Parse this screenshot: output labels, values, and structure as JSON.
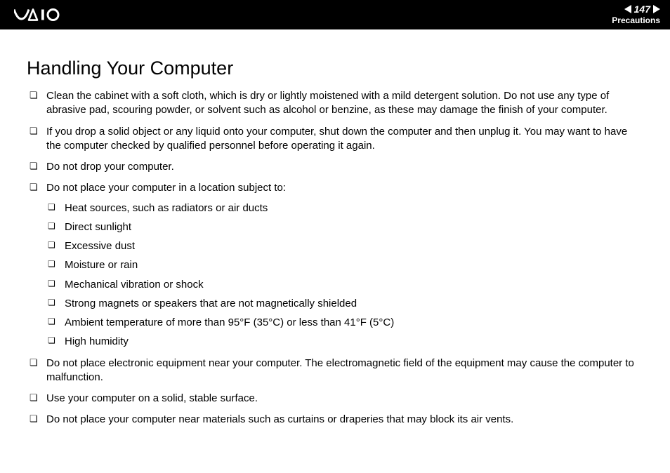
{
  "header": {
    "page_number": "147",
    "section": "Precautions"
  },
  "title": "Handling Your Computer",
  "items": [
    "Clean the cabinet with a soft cloth, which is dry or lightly moistened with a mild detergent solution. Do not use any type of abrasive pad, scouring powder, or solvent such as alcohol or benzine, as these may damage the finish of your computer.",
    "If you drop a solid object or any liquid onto your computer, shut down the computer and then unplug it. You may want to have the computer checked by qualified personnel before operating it again.",
    "Do not drop your computer.",
    "Do not place your computer in a location subject to:",
    "Do not place electronic equipment near your computer. The electromagnetic field of the equipment may cause the computer to malfunction.",
    "Use your computer on a solid, stable surface.",
    "Do not place your computer near materials such as curtains or draperies that may block its air vents."
  ],
  "sub_items": [
    "Heat sources, such as radiators or air ducts",
    "Direct sunlight",
    "Excessive dust",
    "Moisture or rain",
    "Mechanical vibration or shock",
    "Strong magnets or speakers that are not magnetically shielded",
    "Ambient temperature of more than 95°F (35°C) or less than 41°F (5°C)",
    "High humidity"
  ]
}
